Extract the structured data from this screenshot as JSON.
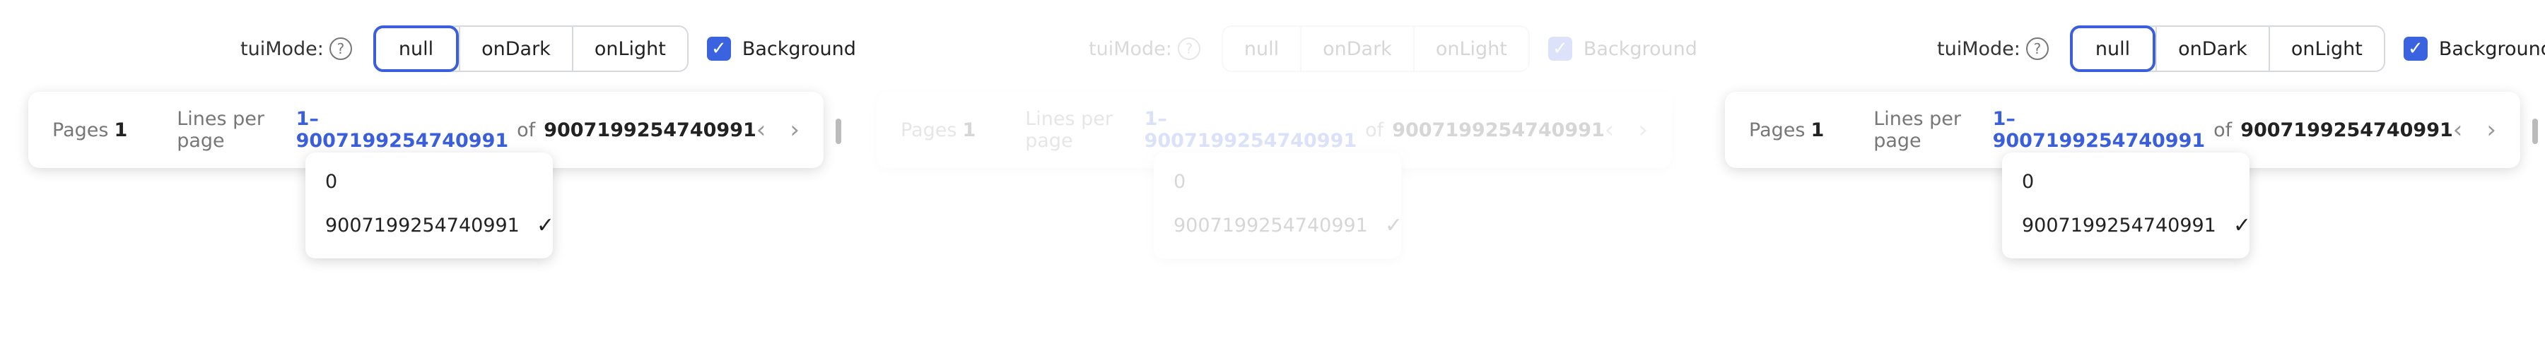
{
  "toolbar": {
    "mode_label": "tuiMode:",
    "help_icon": "?",
    "segments": [
      "null",
      "onDark",
      "onLight"
    ],
    "background_label": "Background",
    "checkbox_mark": "✓"
  },
  "pagination": {
    "pages_label": "Pages",
    "pages_value": "1",
    "lines_label": "Lines per page",
    "range": "1–9007199254740991",
    "of_label": "of",
    "total": "9007199254740991",
    "prev_icon": "‹",
    "next_icon": "›"
  },
  "dropdown": {
    "items": [
      "0",
      "9007199254740991"
    ],
    "check_mark": "✓"
  }
}
